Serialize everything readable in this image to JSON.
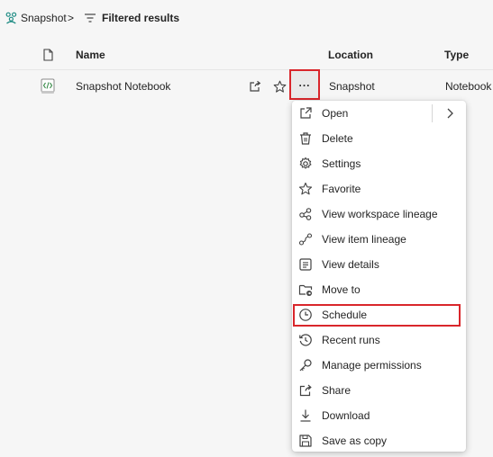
{
  "breadcrumb": {
    "workspace": "Snapshot",
    "separator": ">",
    "current": "Filtered results"
  },
  "table": {
    "columns": {
      "name": "Name",
      "location": "Location",
      "type": "Type"
    },
    "row": {
      "name": "Snapshot Notebook",
      "location": "Snapshot",
      "type": "Notebook",
      "more": "..."
    }
  },
  "menu": {
    "items": [
      {
        "label": "Open",
        "icon": "open-in-new-icon",
        "has_submenu": true
      },
      {
        "label": "Delete",
        "icon": "trash-icon"
      },
      {
        "label": "Settings",
        "icon": "gear-icon"
      },
      {
        "label": "Favorite",
        "icon": "star-icon"
      },
      {
        "label": "View workspace lineage",
        "icon": "lineage-icon"
      },
      {
        "label": "View item lineage",
        "icon": "item-lineage-icon"
      },
      {
        "label": "View details",
        "icon": "details-icon"
      },
      {
        "label": "Move to",
        "icon": "folder-move-icon"
      },
      {
        "label": "Schedule",
        "icon": "clock-icon",
        "highlighted": true
      },
      {
        "label": "Recent runs",
        "icon": "history-icon"
      },
      {
        "label": "Manage permissions",
        "icon": "key-icon"
      },
      {
        "label": "Share",
        "icon": "share-icon"
      },
      {
        "label": "Download",
        "icon": "download-icon"
      },
      {
        "label": "Save as copy",
        "icon": "save-copy-icon"
      }
    ]
  },
  "colors": {
    "highlight_border": "#d9262b",
    "menu_background": "#ffffff",
    "page_background": "#f6f6f6",
    "workspace_icon": "#1b8a82",
    "notebook_icon": "#2e8540"
  }
}
